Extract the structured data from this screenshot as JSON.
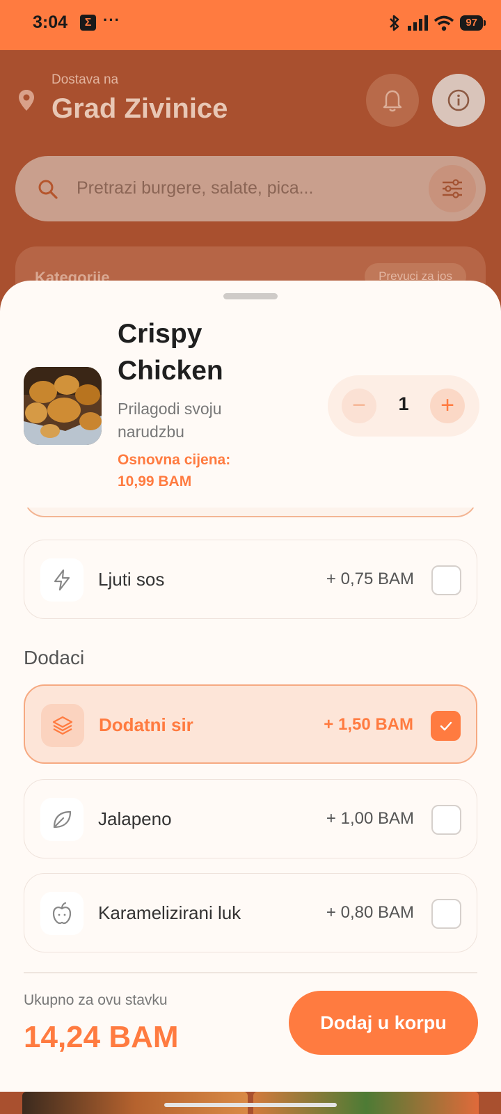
{
  "status_bar": {
    "time": "3:04",
    "app_badge": "Σ",
    "dots": "···",
    "battery": "97"
  },
  "header": {
    "deliver_label": "Dostava na",
    "city": "Grad Zivinice"
  },
  "search": {
    "placeholder": "Pretrazi burgere, salate, pica..."
  },
  "categories": {
    "title": "Kategorije",
    "more": "Prevuci za jos"
  },
  "product": {
    "name": "Crispy Chicken",
    "subtitle": "Prilagodi svoju narudzbu",
    "base_price_label": "Osnovna cijena:",
    "base_price": "10,99 BAM",
    "quantity": "1",
    "minus": "−",
    "plus": "+"
  },
  "sauces": [
    {
      "label": "Ljuti sos",
      "price": "+ 0,75 BAM",
      "icon": "bolt-icon",
      "checked": false
    }
  ],
  "extras_title": "Dodaci",
  "extras": [
    {
      "label": "Dodatni sir",
      "price": "+ 1,50 BAM",
      "icon": "layers-icon",
      "checked": true
    },
    {
      "label": "Jalapeno",
      "price": "+ 1,00 BAM",
      "icon": "leaf-icon",
      "checked": false
    },
    {
      "label": "Karamelizirani luk",
      "price": "+ 0,80 BAM",
      "icon": "apple-icon",
      "checked": false
    }
  ],
  "footer": {
    "total_label": "Ukupno za ovu stavku",
    "total": "14,24 BAM",
    "add_button": "Dodaj u korpu"
  },
  "colors": {
    "accent": "#ff7b40",
    "overlay": "#a9502f",
    "sheet": "#fffaf6"
  }
}
